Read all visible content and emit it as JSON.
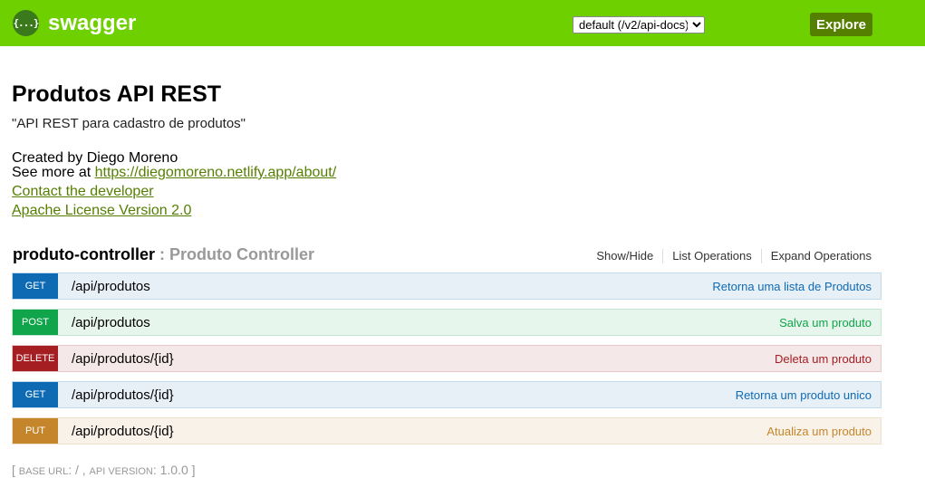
{
  "header": {
    "logo_icon": "swagger-braces-icon",
    "logo_glyph": "{...}",
    "brand": "swagger",
    "spec_select_value": "default (/v2/api-docs)",
    "explore_label": "Explore",
    "colors": {
      "bar": "#6fd000",
      "explore": "#547f00"
    }
  },
  "info": {
    "title": "Produtos API REST",
    "description": "\"API REST para cadastro de produtos\"",
    "created_by": "Created by Diego Moreno",
    "see_more_prefix": "See more at ",
    "see_more_link": "https://diegomoreno.netlify.app/about/",
    "contact": "Contact the developer",
    "license": "Apache License Version 2.0"
  },
  "controller": {
    "name": "produto-controller",
    "separator": " : ",
    "description": "Produto Controller",
    "show_hide": "Show/Hide",
    "list_operations": "List Operations",
    "expand_operations": "Expand Operations"
  },
  "operations": [
    {
      "method": "GET",
      "path": "/api/produtos",
      "summary": "Retorna uma lista de Produtos"
    },
    {
      "method": "POST",
      "path": "/api/produtos",
      "summary": "Salva um produto"
    },
    {
      "method": "DELETE",
      "path": "/api/produtos/{id}",
      "summary": "Deleta um produto"
    },
    {
      "method": "GET",
      "path": "/api/produtos/{id}",
      "summary": "Retorna um produto unico"
    },
    {
      "method": "PUT",
      "path": "/api/produtos/{id}",
      "summary": "Atualiza um produto"
    }
  ],
  "footer": {
    "open": "[ ",
    "base_url_label": "base url",
    "base_url_value": ": / , ",
    "api_version_label": "api version",
    "api_version_value": ": 1.0.0 ]"
  }
}
